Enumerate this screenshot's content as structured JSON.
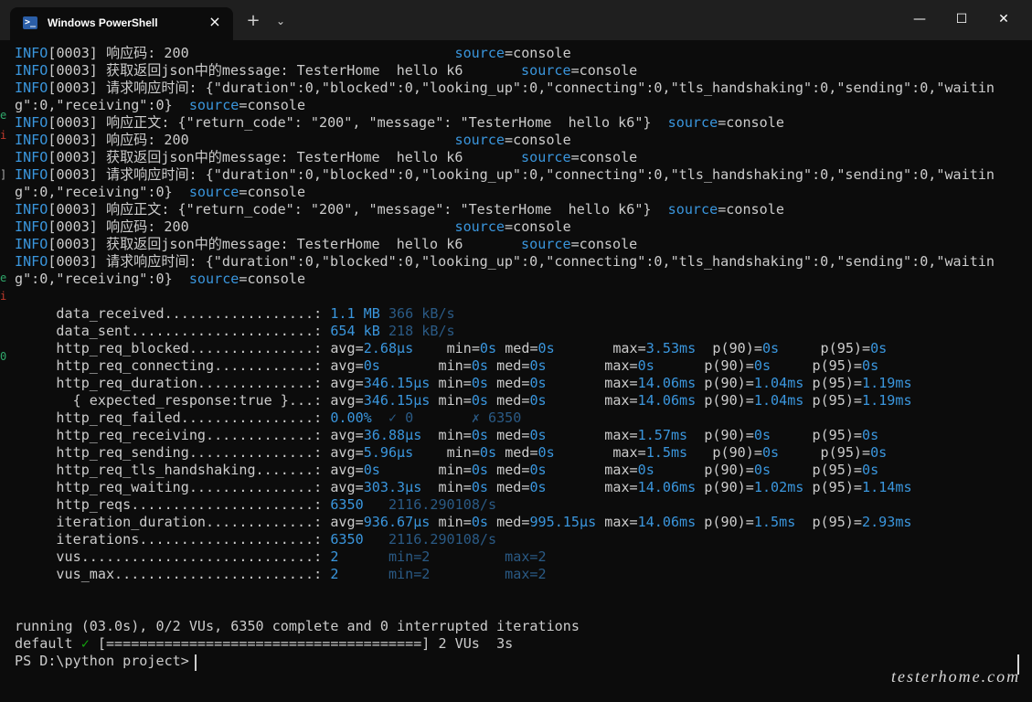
{
  "window": {
    "tab_title": "Windows PowerShell",
    "tab_icon": "powershell-icon",
    "close_tab": "×",
    "new_tab": "+",
    "dropdown": "⌄",
    "minimize": "—",
    "maximize": "☐",
    "close": "✕"
  },
  "log": {
    "resp_code": {
      "info": "INFO",
      "text": "[0003] 响应码: 200                                ",
      "src": "source",
      "rest": "=console"
    },
    "json_msg": {
      "info": "INFO",
      "text": "[0003] 获取返回json中的message: TesterHome  hello k6       ",
      "src": "source",
      "rest": "=console"
    },
    "resp_time_a": {
      "info": "INFO",
      "text": "[0003] 请求响应时间: {\"duration\":0,\"blocked\":0,\"looking_up\":0,\"connecting\":0,\"tls_handshaking\":0,\"sending\":0,\"waitin"
    },
    "resp_time_b": {
      "text": "g\":0,\"receiving\":0}  ",
      "src": "source",
      "rest": "=console"
    },
    "resp_body": {
      "info": "INFO",
      "text": "[0003] 响应正文: {\"return_code\": \"200\", \"message\": \"TesterHome  hello k6\"}  ",
      "src": "source",
      "rest": "=console"
    }
  },
  "metrics": {
    "data_received": {
      "label": "     data_received..................: ",
      "v1": "1.1 MB",
      "v2": " 366 kB/s"
    },
    "data_sent": {
      "label": "     data_sent......................: ",
      "v1": "654 kB",
      "v2": " 218 kB/s"
    },
    "blocked": {
      "label": "     http_req_blocked...............: ",
      "avg": "2.68µs",
      "min": "0s",
      "med": "0s",
      "max": "3.53ms",
      "p90": "0s",
      "p95": "0s"
    },
    "connecting": {
      "label": "     http_req_connecting............: ",
      "avg": "0s",
      "min": "0s",
      "med": "0s",
      "max": "0s",
      "p90": "0s",
      "p95": "0s"
    },
    "duration": {
      "label": "     http_req_duration..............: ",
      "avg": "346.15µs",
      "min": "0s",
      "med": "0s",
      "max": "14.06ms",
      "p90": "1.04ms",
      "p95": "1.19ms"
    },
    "expected": {
      "label": "       { expected_response:true }...: ",
      "avg": "346.15µs",
      "min": "0s",
      "med": "0s",
      "max": "14.06ms",
      "p90": "1.04ms",
      "p95": "1.19ms"
    },
    "failed": {
      "label": "     http_req_failed................: ",
      "v1": "0.00%",
      "v2": "  ✓ 0",
      "v3": "       ✗ 6350"
    },
    "receiving": {
      "label": "     http_req_receiving.............: ",
      "avg": "36.88µs",
      "min": "0s",
      "med": "0s",
      "max": "1.57ms",
      "p90": "0s",
      "p95": "0s"
    },
    "sending": {
      "label": "     http_req_sending...............: ",
      "avg": "5.96µs",
      "min": "0s",
      "med": "0s",
      "max": "1.5ms",
      "p90": "0s",
      "p95": "0s"
    },
    "tls": {
      "label": "     http_req_tls_handshaking.......: ",
      "avg": "0s",
      "min": "0s",
      "med": "0s",
      "max": "0s",
      "p90": "0s",
      "p95": "0s"
    },
    "waiting": {
      "label": "     http_req_waiting...............: ",
      "avg": "303.3µs",
      "min": "0s",
      "med": "0s",
      "max": "14.06ms",
      "p90": "1.02ms",
      "p95": "1.14ms"
    },
    "reqs": {
      "label": "     http_reqs......................: ",
      "v1": "6350",
      "v2": "   2116.290108/s"
    },
    "iter_duration": {
      "label": "     iteration_duration.............: ",
      "avg": "936.67µs",
      "min": "0s",
      "med": "995.15µs",
      "max": "14.06ms",
      "p90": "1.5ms",
      "p95": "2.93ms"
    },
    "iterations": {
      "label": "     iterations.....................: ",
      "v1": "6350",
      "v2": "   2116.290108/s"
    },
    "vus": {
      "label": "     vus............................: ",
      "v1": "2",
      "v2": "      min=2",
      "v3": "         max=2"
    },
    "vus_max": {
      "label": "     vus_max........................: ",
      "v1": "2",
      "v2": "      min=2",
      "v3": "         max=2"
    }
  },
  "status": {
    "running": "running (03.0s), 0/2 VUs, 6350 complete and 0 interrupted iterations",
    "default_label": "default ",
    "check": "✓",
    "bar": " [======================================] 2 VUs  3s",
    "prompt": "PS D:\\python project> "
  },
  "watermark": "testerhome.com"
}
